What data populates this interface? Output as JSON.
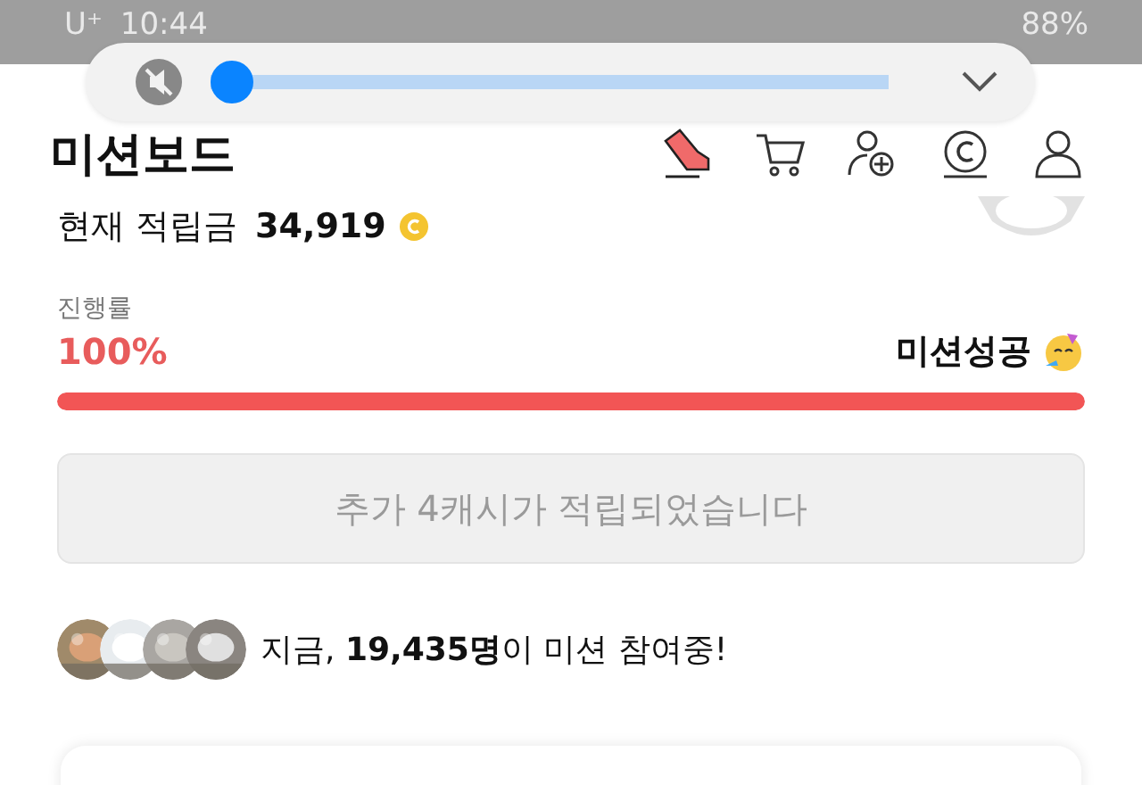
{
  "status_bar": {
    "carrier": "U⁺",
    "time": "10:44",
    "battery": "88%"
  },
  "volume_panel": {
    "muted": true,
    "level": 0.0
  },
  "header": {
    "title": "미션보드"
  },
  "balance": {
    "label": "현재 적립금",
    "amount": "34,919"
  },
  "progress": {
    "label": "진행률",
    "percent": "100%",
    "status": "미션성공",
    "level": 1.0
  },
  "notice": {
    "text": "추가 4캐시가 적립되었습니다"
  },
  "participants": {
    "text": "지금, **19,435명**이 미션 참여중!"
  }
}
